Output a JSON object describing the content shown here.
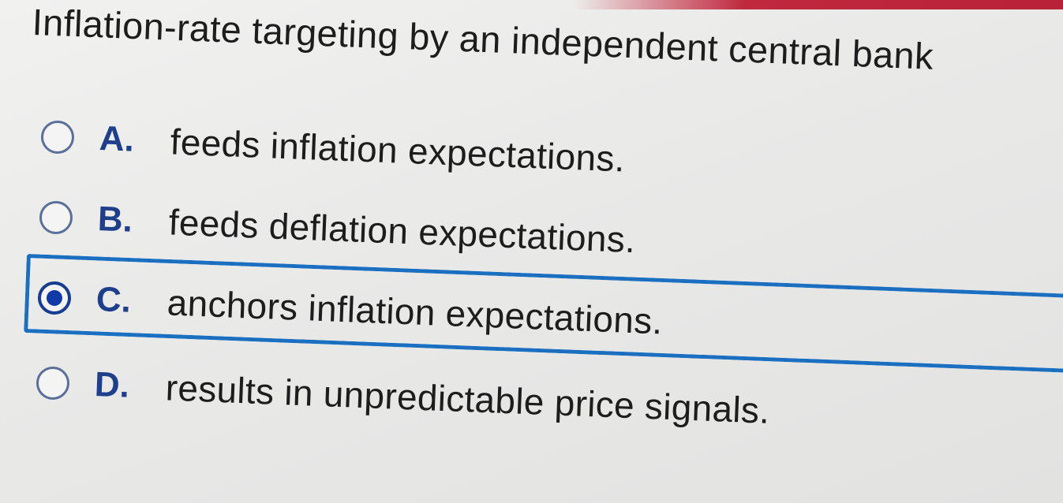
{
  "question": {
    "prompt": "Inflation-rate targeting by an independent central bank"
  },
  "options": [
    {
      "letter": "A.",
      "text": "feeds inflation expectations.",
      "selected": false
    },
    {
      "letter": "B.",
      "text": "feeds deflation expectations.",
      "selected": false
    },
    {
      "letter": "C.",
      "text": "anchors inflation expectations.",
      "selected": true
    },
    {
      "letter": "D.",
      "text": "results in unpredictable price signals.",
      "selected": false
    }
  ],
  "colors": {
    "selection_border": "#1a6fc0",
    "radio_fill": "#0f3aa8",
    "letter": "#1e3f8c",
    "top_strip": "#c0283e"
  }
}
